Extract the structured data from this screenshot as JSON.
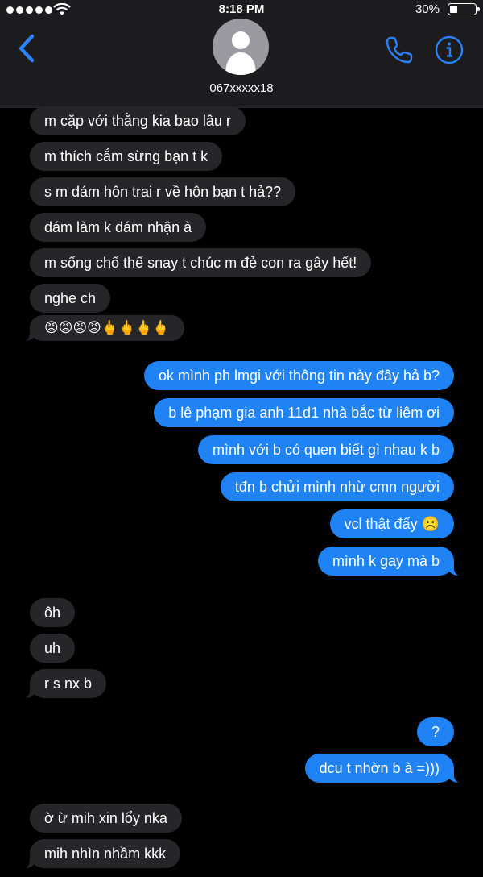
{
  "status_bar": {
    "time": "8:18 PM",
    "battery": "30%"
  },
  "header": {
    "contact": "067xxxxx18"
  },
  "colors": {
    "sent_bubble": "#1f83f5",
    "received_bubble": "#262629",
    "accent": "#2b82f6"
  },
  "messages": [
    {
      "dir": "received",
      "text": "m cặp với thằng kia bao lâu r"
    },
    {
      "dir": "received",
      "text": "m thích cắm sừng bạn t k"
    },
    {
      "dir": "received",
      "text": "s m dám hôn trai r về hôn bạn t hả??"
    },
    {
      "dir": "received",
      "text": "dám làm k dám nhận à"
    },
    {
      "dir": "received",
      "text": "m sống chố thế snay t chúc m đẻ con ra gây hết!"
    },
    {
      "dir": "received",
      "text": "nghe ch"
    },
    {
      "dir": "received",
      "text": "😡😡😡😡🖕🖕🖕🖕"
    },
    {
      "dir": "sent",
      "text": "ok mình ph lmgi với thông tin này đây hả b?"
    },
    {
      "dir": "sent",
      "text": "b lê phạm gia anh 11d1 nhà bắc từ liêm ơi"
    },
    {
      "dir": "sent",
      "text": "mình với b có quen biết gì nhau k b"
    },
    {
      "dir": "sent",
      "text": "tđn b chửi mình nhừ cmn người"
    },
    {
      "dir": "sent",
      "text": "vcl thật đấy ☹️"
    },
    {
      "dir": "sent",
      "text": "mình k gay mà b"
    },
    {
      "dir": "received",
      "text": "ôh"
    },
    {
      "dir": "received",
      "text": "uh"
    },
    {
      "dir": "received",
      "text": "r s nx b"
    },
    {
      "dir": "sent",
      "text": "?"
    },
    {
      "dir": "sent",
      "text": "dcu t nhờn b à =)))"
    },
    {
      "dir": "received",
      "text": "ờ ừ mih xin lổy nka"
    },
    {
      "dir": "received",
      "text": "mih nhìn nhầm kkk"
    }
  ]
}
